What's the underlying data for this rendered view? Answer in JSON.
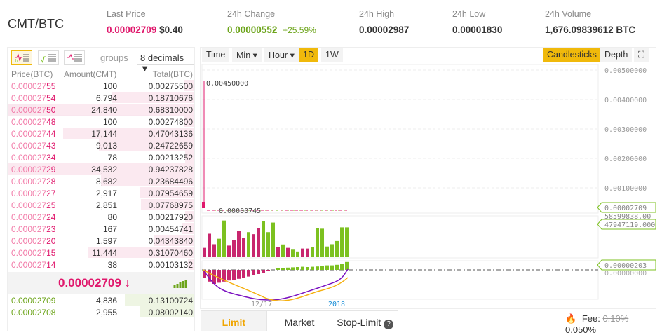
{
  "header": {
    "pair": "CMT/BTC",
    "last_price": {
      "label": "Last Price",
      "btc": "0.00002709",
      "usd": "$0.40"
    },
    "change": {
      "label": "24h Change",
      "value": "0.00000552",
      "pct": "+25.59%"
    },
    "high": {
      "label": "24h High",
      "value": "0.00002987"
    },
    "low": {
      "label": "24h Low",
      "value": "0.00001830"
    },
    "volume": {
      "label": "24h Volume",
      "value": "1,676.09839612 BTC"
    }
  },
  "orderbook": {
    "groups_label": "groups",
    "decimals": "8 decimals ▼",
    "cols": [
      "Price(BTC)",
      "Amount(CMT)",
      "Total(BTC)"
    ],
    "asks": [
      [
        "0.000027",
        "55",
        "100",
        "0.00275500"
      ],
      [
        "0.000027",
        "54",
        "6,794",
        "0.18710676"
      ],
      [
        "0.000027",
        "50",
        "24,840",
        "0.68310000"
      ],
      [
        "0.000027",
        "48",
        "100",
        "0.00274800"
      ],
      [
        "0.000027",
        "44",
        "17,144",
        "0.47043136"
      ],
      [
        "0.000027",
        "43",
        "9,013",
        "0.24722659"
      ],
      [
        "0.000027",
        "34",
        "78",
        "0.00213252"
      ],
      [
        "0.000027",
        "29",
        "34,532",
        "0.94237828"
      ],
      [
        "0.000027",
        "28",
        "8,682",
        "0.23684496"
      ],
      [
        "0.000027",
        "27",
        "2,917",
        "0.07954659"
      ],
      [
        "0.000027",
        "25",
        "2,851",
        "0.07768975"
      ],
      [
        "0.000027",
        "24",
        "80",
        "0.00217920"
      ],
      [
        "0.000027",
        "23",
        "167",
        "0.00454741"
      ],
      [
        "0.000027",
        "20",
        "1,597",
        "0.04343840"
      ],
      [
        "0.000027",
        "15",
        "11,444",
        "0.31070460"
      ],
      [
        "0.000027",
        "14",
        "38",
        "0.00103132"
      ]
    ],
    "last": "0.00002709 ↓",
    "bids": [
      [
        "0.000027",
        "09",
        "4,836",
        "0.13100724"
      ],
      [
        "0.000027",
        "08",
        "2,955",
        "0.08002140"
      ]
    ]
  },
  "chart": {
    "toolbar": [
      "Time",
      "Min ▾",
      "Hour ▾",
      "1D",
      "1W"
    ],
    "active": "1D",
    "view": [
      "Candlesticks",
      "Depth"
    ],
    "active_view": "Candlesticks",
    "axis": [
      "0.00500000",
      "0.00400000",
      "0.00300000",
      "0.00200000",
      "0.00100000"
    ],
    "high_label": "0.00450000",
    "low_label": "0.00000745",
    "price_tag": "0.00002709",
    "vol_max": "58599838.00",
    "vol_tag": "47947119.000",
    "macd_tag": "0.00000203",
    "macd_zero": "0.00000000",
    "dates": [
      "12/17",
      "2018"
    ],
    "volume": [
      38,
      100,
      54,
      78,
      158,
      48,
      72,
      113,
      80,
      107,
      98,
      125,
      155,
      107,
      149,
      41,
      53,
      38,
      30,
      22,
      35,
      35,
      41,
      125,
      122,
      44,
      54,
      68,
      128,
      128
    ],
    "volume_up": [
      0,
      0,
      0,
      1,
      1,
      0,
      0,
      0,
      0,
      1,
      0,
      0,
      1,
      1,
      1,
      0,
      1,
      0,
      1,
      1,
      0,
      0,
      1,
      1,
      1,
      1,
      1,
      1,
      1,
      1
    ],
    "macd": [
      -30,
      -42,
      -50,
      -46,
      -42,
      -38,
      -36,
      -32,
      -28,
      -24,
      -20,
      -15,
      -10,
      -5,
      0,
      5,
      7,
      8,
      9,
      10,
      11,
      10,
      11,
      12,
      14,
      16,
      16,
      18,
      22,
      28
    ]
  },
  "order_tabs": [
    "Limit",
    "Market",
    "Stop-Limit"
  ],
  "fee": {
    "label": "Fee:",
    "old": "0.10%",
    "new": "0.050%"
  },
  "colors": {
    "red": "#e0186c",
    "green": "#7cc120",
    "accent": "#f0b90b"
  }
}
